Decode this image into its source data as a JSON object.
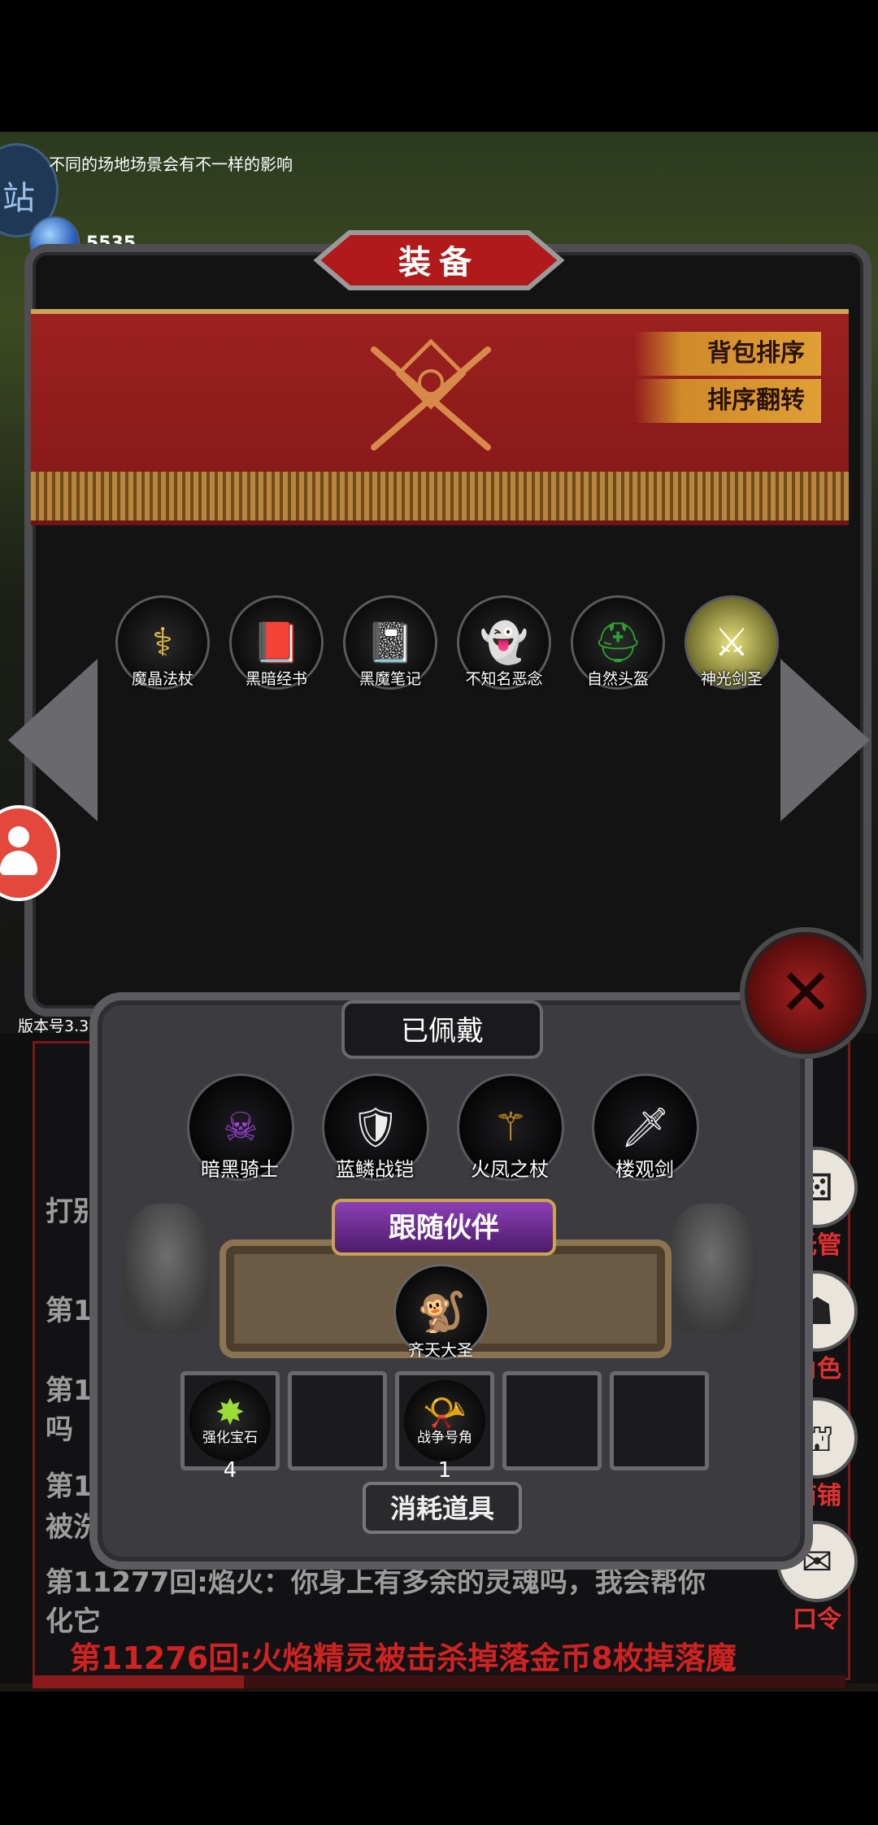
{
  "hint": "不同的场地场景会有不一样的影响",
  "gem": {
    "label": "宝石",
    "value": "5535"
  },
  "left_tab_glyph": "站",
  "panel": {
    "title": "装备",
    "buttons": {
      "sort": "背包排序",
      "reverse": "排序翻转"
    },
    "items": [
      {
        "name": "魔晶法杖",
        "icon": "staff-icon",
        "glyph": "⚕",
        "color": "#e6c24a"
      },
      {
        "name": "黑暗经书",
        "icon": "book-icon",
        "glyph": "📕",
        "color": "#d82424"
      },
      {
        "name": "黑魔笔记",
        "icon": "notebook-icon",
        "glyph": "📓",
        "color": "#cfcfcf"
      },
      {
        "name": "不知名恶念",
        "icon": "ghost-icon",
        "glyph": "👻",
        "color": "#8fa6a0"
      },
      {
        "name": "自然头盔",
        "icon": "helmet-icon",
        "glyph": "⛑",
        "color": "#2ea02e"
      },
      {
        "name": "神光剑圣",
        "icon": "knight-icon",
        "glyph": "⚔",
        "color": "#e8e8e8"
      }
    ]
  },
  "version": "版本号3.39",
  "chat": {
    "lines": [
      "打别",
      "第112",
      "第11",
      "吗",
      "第1",
      "被洗",
      "第11277回:焰火：你身上有多余的灵魂吗，我会帮你",
      "化它"
    ],
    "last": "第11276回:火焰精灵被击杀掉落金币8枚掉落魔"
  },
  "side_menu": [
    {
      "label": "托管",
      "icon": "dice-icon",
      "glyph": "⚄"
    },
    {
      "label": "角色",
      "icon": "hood-icon",
      "glyph": "☗"
    },
    {
      "label": "商铺",
      "icon": "shop-icon",
      "glyph": "⛫"
    },
    {
      "label": "口令",
      "icon": "scroll-icon",
      "glyph": "✉"
    }
  ],
  "equipped": {
    "title": "已佩戴",
    "items": [
      {
        "name": "暗黑骑士",
        "icon": "dark-knight-icon",
        "glyph": "☠",
        "color": "#a040d8"
      },
      {
        "name": "蓝鳞战铠",
        "icon": "armor-icon",
        "glyph": "🛡",
        "color": "#7fb6e6"
      },
      {
        "name": "火凤之杖",
        "icon": "phoenix-staff-icon",
        "glyph": "⚚",
        "color": "#e2a320"
      },
      {
        "name": "楼观剑",
        "icon": "sword-icon",
        "glyph": "🗡",
        "color": "#cfe0e0"
      }
    ],
    "companion_title": "跟随伙伴",
    "companion": {
      "name": "齐天大圣",
      "icon": "monkey-king-icon",
      "glyph": "🐒",
      "color": "#d9902f"
    },
    "consumables": [
      {
        "name": "强化宝石",
        "count": "4",
        "icon": "green-gem-icon",
        "glyph": "✸",
        "color": "#9bdc36"
      },
      {
        "name": "",
        "count": "",
        "icon": "",
        "glyph": "",
        "color": ""
      },
      {
        "name": "战争号角",
        "count": "1",
        "icon": "war-horn-icon",
        "glyph": "📯",
        "color": "#d8d8e8"
      },
      {
        "name": "",
        "count": "",
        "icon": "",
        "glyph": "",
        "color": ""
      },
      {
        "name": "",
        "count": "",
        "icon": "",
        "glyph": "",
        "color": ""
      }
    ],
    "consume_label": "消耗道具"
  },
  "close_glyph": "✕"
}
